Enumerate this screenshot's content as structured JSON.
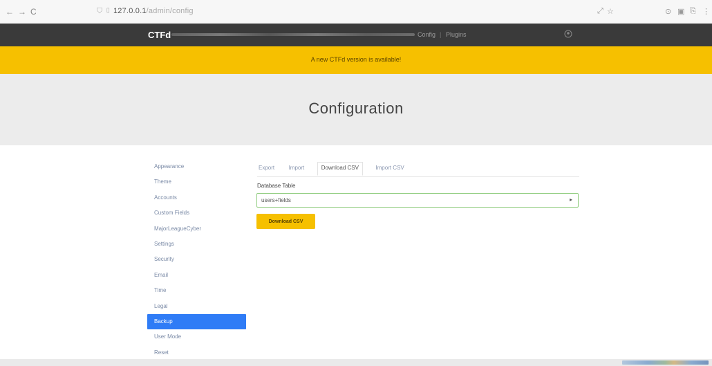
{
  "browser": {
    "back_glyph": "←",
    "forward_glyph": "→",
    "reload_glyph": "C",
    "url_host": "127.0.0.1",
    "url_path": "/admin/config",
    "right_icons": [
      "☆",
      "⊙",
      "▣",
      "⎘",
      "⋮"
    ]
  },
  "navbar": {
    "brand": "CTFd",
    "config_link": "Config",
    "separator": "|",
    "plugins_link": "Plugins"
  },
  "banner": {
    "text": "A new CTFd version is available!",
    "color": "#f6c000"
  },
  "header": {
    "title": "Configuration"
  },
  "sidebar": {
    "items": [
      {
        "label": "Appearance",
        "active": false
      },
      {
        "label": "Theme",
        "active": false
      },
      {
        "label": "Accounts",
        "active": false
      },
      {
        "label": "Custom Fields",
        "active": false
      },
      {
        "label": "MajorLeagueCyber",
        "active": false
      },
      {
        "label": "Settings",
        "active": false
      },
      {
        "label": "Security",
        "active": false
      },
      {
        "label": "Email",
        "active": false
      },
      {
        "label": "Time",
        "active": false
      },
      {
        "label": "Legal",
        "active": false
      },
      {
        "label": "Backup",
        "active": true
      },
      {
        "label": "User Mode",
        "active": false
      },
      {
        "label": "Reset",
        "active": false
      }
    ],
    "active_color": "#2f7cf6"
  },
  "tabs": [
    {
      "label": "Export",
      "active": false
    },
    {
      "label": "Import",
      "active": false
    },
    {
      "label": "Download CSV",
      "active": true
    },
    {
      "label": "Import CSV",
      "active": false
    }
  ],
  "form": {
    "table_label": "Database Table",
    "table_value": "users+fields",
    "download_button": "Download CSV"
  }
}
